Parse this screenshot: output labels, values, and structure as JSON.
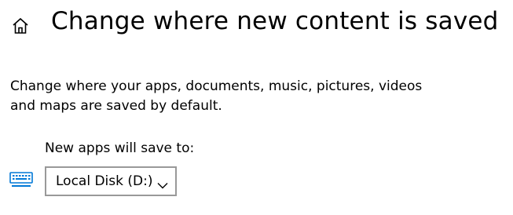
{
  "header": {
    "home_icon": "home-icon",
    "title": "Change where new content is saved"
  },
  "main": {
    "description": "Change where your apps, documents, music, pictures, videos and maps are saved by default.",
    "apps_setting": {
      "label": "New apps will save to:",
      "icon": "keyboard-monitor-icon",
      "selected_value": "Local Disk (D:)",
      "accent_color": "#0078d7",
      "border_color": "#999999"
    }
  }
}
